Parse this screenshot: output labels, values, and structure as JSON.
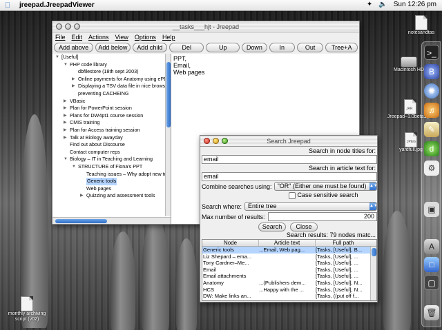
{
  "menubar": {
    "app_name": "jreepad.JreepadViewer",
    "clock": "Sun 12:26 pm"
  },
  "main_window": {
    "title": "__tasks___hjt - Jreepad",
    "menus": [
      "File",
      "Edit",
      "Actions",
      "View",
      "Options",
      "Help"
    ],
    "toolbar": [
      "Add above",
      "Add below",
      "Add child",
      "Del",
      "Up",
      "Down",
      "In",
      "Out",
      "Tree+A"
    ],
    "tree": [
      {
        "label": "[Useful]",
        "indent": 0,
        "toggle": "open"
      },
      {
        "label": "PHP code library",
        "indent": 1,
        "toggle": "open"
      },
      {
        "label": "dbfilestore (18th sept 2003)",
        "indent": 2,
        "toggle": ""
      },
      {
        "label": "Online payments for Anatomy using ePD",
        "indent": 2,
        "toggle": "closed"
      },
      {
        "label": "Displaying a TSV data file in nice browsa",
        "indent": 2,
        "toggle": "closed"
      },
      {
        "label": "preventing CACHEING",
        "indent": 2,
        "toggle": ""
      },
      {
        "label": "VBasic",
        "indent": 1,
        "toggle": "closed"
      },
      {
        "label": "Plan for PowerPoint session",
        "indent": 1,
        "toggle": "closed"
      },
      {
        "label": "Plans for DW4pt1 course session",
        "indent": 1,
        "toggle": "closed"
      },
      {
        "label": "CMIS training",
        "indent": 1,
        "toggle": "closed"
      },
      {
        "label": "Plan for Access training session",
        "indent": 1,
        "toggle": "closed"
      },
      {
        "label": "Talk at Biology awayday",
        "indent": 1,
        "toggle": "closed"
      },
      {
        "label": "Find out about Discourse",
        "indent": 1,
        "toggle": ""
      },
      {
        "label": "Contact computer reps",
        "indent": 1,
        "toggle": ""
      },
      {
        "label": "Biology – IT in Teaching and Learning",
        "indent": 1,
        "toggle": "open"
      },
      {
        "label": "STRUCTURE of Fiona's PPT",
        "indent": 2,
        "toggle": "open"
      },
      {
        "label": "Teaching issues – Why adopt new te",
        "indent": 3,
        "toggle": ""
      },
      {
        "label": "Generic tools",
        "indent": 3,
        "toggle": "",
        "selected": true
      },
      {
        "label": "Web pages",
        "indent": 3,
        "toggle": ""
      },
      {
        "label": "Quizzing and assessment tools",
        "indent": 3,
        "toggle": "closed"
      }
    ],
    "article_lines": [
      "PPT,",
      "Email,",
      "Web pages"
    ]
  },
  "search_window": {
    "title": "Search Jreepad",
    "node_titles_label": "Search in node titles for:",
    "node_titles_value": "email",
    "article_text_label": "Search in article text for:",
    "article_text_value": "email",
    "combine_label": "Combine searches using:",
    "combine_value": "\"OR\" (Either one must be found)",
    "case_sensitive_label": "Case sensitive search",
    "search_where_label": "Search where:",
    "search_where_value": "Entire tree",
    "max_results_label": "Max number of results:",
    "max_results_value": "200",
    "search_button": "Search",
    "close_button": "Close",
    "results_status": "Search results: 79 nodes matc...",
    "columns": [
      "Node",
      "Article text",
      "Full path"
    ],
    "rows": [
      {
        "node": "Generic tools",
        "article": "...Email, Web pag...",
        "path": "[Tasks, [Useful], B...",
        "selected": true
      },
      {
        "node": "Liz Shepard – ema...",
        "article": "",
        "path": "[Tasks, [Useful], ..."
      },
      {
        "node": "Tony Cardner–Me...",
        "article": "",
        "path": "[Tasks, [Useful], ..."
      },
      {
        "node": "Email",
        "article": "",
        "path": "[Tasks, [Useful], ..."
      },
      {
        "node": "Email attachments",
        "article": "",
        "path": "[Tasks, [Useful], ..."
      },
      {
        "node": "Anatomy",
        "article": "...(Publishers dem...",
        "path": "[Tasks, [Useful], N..."
      },
      {
        "node": "HCS",
        "article": "...Happy with the ...",
        "path": "[Tasks, [Useful], N..."
      },
      {
        "node": "DW: Make links an...",
        "article": "",
        "path": "[Tasks, ((put off f..."
      }
    ]
  },
  "desktop_icons": [
    {
      "label": "notesandtas",
      "icon": "document-icon"
    },
    {
      "label": "Macintosh HD",
      "icon": "hard-drive-icon"
    },
    {
      "label": "Jreepad–1.0beta1.jar",
      "icon": "jar-icon"
    },
    {
      "label": "yardfull.jpg",
      "icon": "image-file-icon"
    },
    {
      "label": "monthly archiving script (v02)",
      "icon": "script-icon"
    }
  ],
  "colors": {
    "selection": "#b5d5ff",
    "aqua_blue": "#2f6fc9"
  }
}
